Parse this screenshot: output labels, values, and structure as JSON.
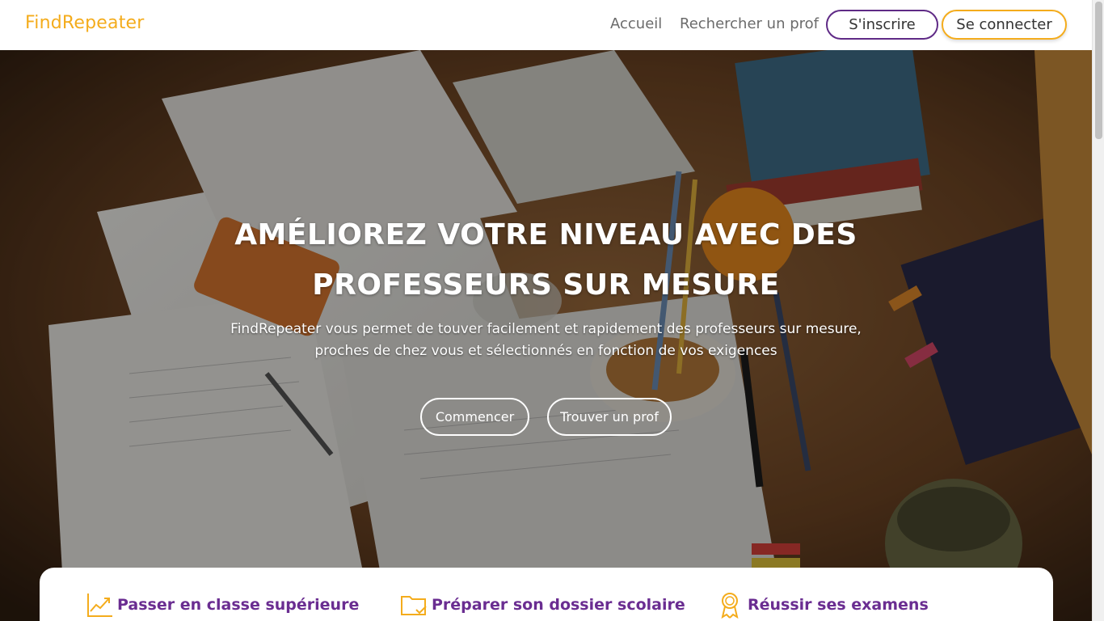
{
  "header": {
    "brand": "FindRepeater",
    "nav": {
      "home": "Accueil",
      "search": "Rechercher un prof"
    },
    "signup_label": "S'inscrire",
    "login_label": "Se connecter"
  },
  "hero": {
    "title_line1": "AMÉLIOREZ VOTRE NIVEAU AVEC DES",
    "title_line2": "PROFESSEURS SUR MESURE",
    "subtitle_line1": "FindRepeater vous permet de touver facilement et rapidement des professeurs sur mesure,",
    "subtitle_line2": "proches de chez vous et sélectionnés en fonction de vos exigences",
    "start_label": "Commencer",
    "find_label": "Trouver un prof",
    "background_icon": "study-desk-photo"
  },
  "features": [
    {
      "icon": "chart-line-up-icon",
      "label": "Passer en classe supérieure"
    },
    {
      "icon": "folder-check-icon",
      "label": "Préparer son dossier scolaire"
    },
    {
      "icon": "award-medal-icon",
      "label": "Réussir ses examens"
    }
  ],
  "colors": {
    "brand": "#f4ac1c",
    "purple": "#6a2d91",
    "signup_border": "#5f2a86",
    "login_border": "#f4ac1c"
  }
}
